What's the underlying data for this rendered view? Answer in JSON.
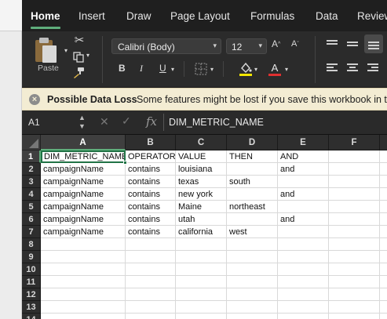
{
  "ribbon_tabs": [
    "Home",
    "Insert",
    "Draw",
    "Page Layout",
    "Formulas",
    "Data",
    "Review"
  ],
  "active_tab": "Home",
  "ribbon": {
    "paste_label": "Paste",
    "font_name": "Calibri (Body)",
    "font_size": "12",
    "bold": "B",
    "italic": "I",
    "underline": "U",
    "increase_font": "A^",
    "decrease_font": "Aˇ",
    "font_color_letter": "A"
  },
  "message_bar": {
    "title": "Possible Data Loss",
    "text": "Some features might be lost if you save this workbook in the"
  },
  "formula_bar": {
    "name_box": "A1",
    "fx": "fx",
    "value": "DIM_METRIC_NAME"
  },
  "grid": {
    "columns": [
      "A",
      "B",
      "C",
      "D",
      "E",
      "F"
    ],
    "selected_column": "A",
    "row_numbers": [
      "1",
      "2",
      "3",
      "4",
      "5",
      "6",
      "7",
      "8",
      "9",
      "10",
      "11",
      "12",
      "13",
      "14"
    ],
    "selected_row": "1",
    "rows": [
      [
        "DIM_METRIC_NAME",
        "OPERATOR",
        "VALUE",
        "THEN",
        "AND",
        ""
      ],
      [
        "campaignName",
        "contains",
        "louisiana",
        "",
        "and",
        ""
      ],
      [
        "campaignName",
        "contains",
        "texas",
        "south",
        "",
        ""
      ],
      [
        "campaignName",
        "contains",
        "new york",
        "",
        "and",
        ""
      ],
      [
        "campaignName",
        "contains",
        "Maine",
        "northeast",
        "",
        ""
      ],
      [
        "campaignName",
        "contains",
        "utah",
        "",
        "and",
        ""
      ],
      [
        "campaignName",
        "contains",
        "california",
        "west",
        "",
        ""
      ]
    ]
  },
  "colors": {
    "accent": "#217346",
    "tab_underline": "#5fae7c",
    "message_bar": "#f3ecd3",
    "font_color_bar": "#e03030",
    "highlight_bar": "#f2e600"
  }
}
